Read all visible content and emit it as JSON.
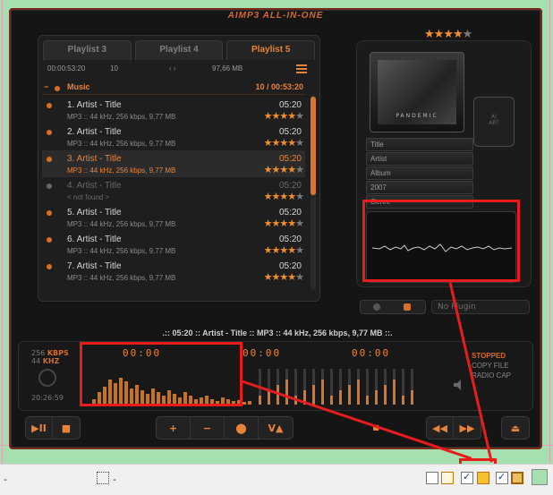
{
  "app": {
    "title": "AIMP3 ALL-IN-ONE",
    "accent_color": "#e8843a",
    "annotation_color": "#e81c1c"
  },
  "playlist": {
    "tabs": [
      {
        "label": "Playlist 3",
        "active": false
      },
      {
        "label": "Playlist 4",
        "active": false
      },
      {
        "label": "Playlist 5",
        "active": true
      }
    ],
    "info": {
      "duration": "00:00:53:20",
      "count": "10",
      "size": "97,66 MB"
    },
    "group": {
      "name": "Music",
      "summary": "10 / 00:53:20"
    },
    "tracks": [
      {
        "title": "1. Artist - Title",
        "meta": "MP3 :: 44 kHz, 256 kbps, 9,77 MB",
        "time": "05:20",
        "rating": 4,
        "state": "normal"
      },
      {
        "title": "2. Artist - Title",
        "meta": "MP3 :: 44 kHz, 256 kbps, 9,77 MB",
        "time": "05:20",
        "rating": 4,
        "state": "normal"
      },
      {
        "title": "3. Artist - Title",
        "meta": "MP3 :: 44 kHz, 256 kbps, 9,77 MB",
        "time": "05:20",
        "rating": 4,
        "state": "playing"
      },
      {
        "title": "4. Artist - Title",
        "meta": "< not found >",
        "time": "05:20",
        "rating": 4,
        "state": "missing"
      },
      {
        "title": "5. Artist - Title",
        "meta": "MP3 :: 44 kHz, 256 kbps, 9,77 MB",
        "time": "05:20",
        "rating": 4,
        "state": "normal"
      },
      {
        "title": "6. Artist - Title",
        "meta": "MP3 :: 44 kHz, 256 kbps, 9,77 MB",
        "time": "05:20",
        "rating": 4,
        "state": "normal"
      },
      {
        "title": "7. Artist - Title",
        "meta": "MP3 :: 44 kHz, 256 kbps, 9,77 MB",
        "time": "05:20",
        "rating": 4,
        "state": "normal"
      }
    ],
    "scroll_position": 0.5
  },
  "now_playing": {
    "rating": 4,
    "cover_caption": "PANDEMIC",
    "chip_label": "Art\nStarfield\nVector",
    "tags": [
      "Title",
      "Artist",
      "Album",
      "2007",
      "Genre"
    ],
    "plugin": "No Plugin",
    "info_line": ".:: 05:20 :: Artist - Title :: MP3 :: 44 kHz, 256 kbps, 9,77 MB ::."
  },
  "display": {
    "bitrate": "256",
    "bitrate_unit": "KBPS",
    "samplerate": "44",
    "samplerate_unit": "KHZ",
    "clock": "20:26:59",
    "time_left": "00:00",
    "time_mid": "00:00",
    "time_right": "00:00",
    "status": "STOPPED",
    "mode1": "COPY FILE",
    "mode2": "RADIO CAP"
  },
  "controls": {
    "playback": [
      "▶II",
      "■"
    ],
    "playlist_ops": [
      "+",
      "−",
      "⬤",
      "V▲"
    ],
    "navigation": [
      "◀◀",
      "▶▶",
      "⏏"
    ]
  },
  "statusbar": {
    "left_text": "-",
    "mid_text": "-",
    "tray_icons": [
      "checkbox-icon",
      "window-icon",
      "checkbox-checked-icon",
      "star-burst-icon",
      "checkbox-checked-icon",
      "frame-icon",
      "color-swatch-icon"
    ]
  }
}
